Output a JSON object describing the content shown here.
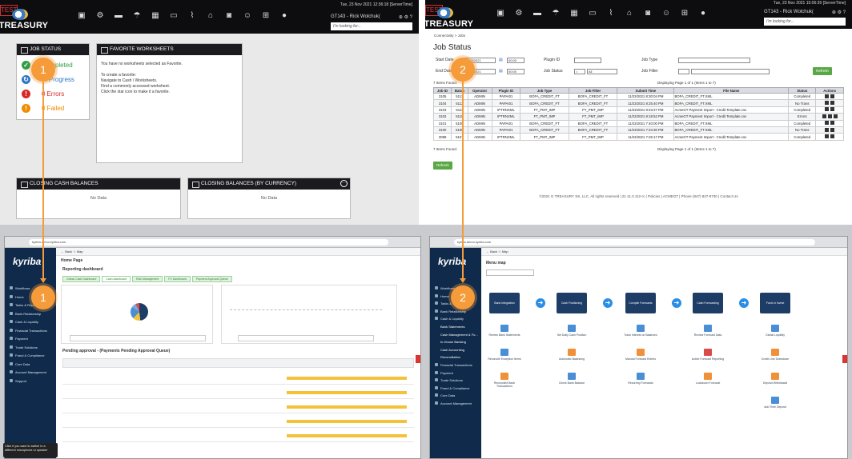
{
  "gtreasury": {
    "test_badge": "TEST",
    "logo_text": "GTREASURY",
    "server_time": "Tue, 23 Nov 2021 12:36:18 [ServerTime]",
    "server_time_2": "Tue, 23 Nov 2021 15:06:39 [ServerTime]",
    "user": "GT143 - Rick Wolchuk(",
    "user_2": "GT143 - Rick Wolchuk(",
    "search_placeholder": "I'm looking for...",
    "nav_icons": [
      "reports-icon",
      "settings-icon",
      "folder-icon",
      "cloud-icon",
      "calculator-icon",
      "monitor-icon",
      "pulse-icon",
      "bank-icon",
      "car-icon",
      "face-icon",
      "org-chart-icon",
      "egg-icon"
    ]
  },
  "job_status_widget": {
    "title": "JOB STATUS",
    "items": [
      {
        "count": "",
        "label": "Completed",
        "color": "#2f9e44",
        "symbol": "✓"
      },
      {
        "count": "",
        "label": "In Progress",
        "color": "#2f78c4",
        "symbol": "↻"
      },
      {
        "count": "0",
        "label": "Errors",
        "color": "#d62828",
        "symbol": "!"
      },
      {
        "count": "0",
        "label": "Failed",
        "color": "#f08c00",
        "symbol": "!"
      }
    ]
  },
  "favorite_worksheets": {
    "title": "FAVORITE WORKSHEETS",
    "empty_msg": "You have no worksheets selected as Favorite.",
    "howto_title": "To create a favorite:",
    "steps": [
      "Navigate to Cash \\ Worksheets.",
      "Find a commonly accessed worksheet.",
      "Click the star icon to make it a favorite."
    ]
  },
  "closing_cash": {
    "title": "CLOSING CASH BALANCES",
    "body": "No Data"
  },
  "closing_currency": {
    "title": "CLOSING BALANCES (BY CURRENCY)",
    "body": "No Data"
  },
  "markers": {
    "one": "1",
    "two": "2"
  },
  "job_status_page": {
    "breadcrumb": "Connectivity > Jobs",
    "title": "Job Status",
    "start_date_label": "Start Date",
    "end_date_label": "End Date",
    "start_date": "11/23/2021",
    "end_date": "11/23/2021",
    "time_start": "00:00",
    "time_end": "00:00",
    "plugin_id_label": "Plugin ID",
    "job_status_label": "Job Status",
    "job_status_op": "=",
    "job_status_value": "All",
    "job_type_label": "Job Type",
    "job_filter_label": "Job Filter",
    "refresh_label": "Refresh",
    "items_found": "7 Items Found.",
    "paging": "Displaying Page 1 of 1 (Items 1 to 7)",
    "columns": [
      "Job ID",
      "Batch",
      "Operator",
      "Plugin ID",
      "Job Type",
      "Job Filter",
      "Submit Time",
      "File Name",
      "Status",
      "Actions"
    ],
    "rows": [
      [
        "3105",
        "5113",
        "ADMIN",
        "PAPAI01",
        "BOFA_CREDIT_FT",
        "BOFA_CREDIT_FT",
        "11/23/2021 8:30:04 PM",
        "BOFA_CREDIT_FT.XML",
        "Completed"
      ],
      [
        "3104",
        "5112",
        "ADMIN",
        "PAPAI01",
        "BOFA_CREDIT_FT",
        "BOFA_CREDIT_FT",
        "11/23/2021 8:25:40 PM",
        "BOFA_CREDIT_FT.XML",
        "No Trans"
      ],
      [
        "3103",
        "5111",
        "ADMIN",
        "IPTRNXML",
        "FT_PMT_IMP",
        "FT_PMT_IMP",
        "11/23/2021 8:23:27 PM",
        "AcmeGT Payment Import - Credit Template.csv",
        "Completed"
      ],
      [
        "3102",
        "5110",
        "ADMIN",
        "IPTRNXML",
        "FT_PMT_IMP",
        "FT_PMT_IMP",
        "11/23/2021 8:18:52 PM",
        "AcmeGT Payment Import - Credit Template.csv",
        "Errors"
      ],
      [
        "3101",
        "5109",
        "ADMIN",
        "PAPAI01",
        "BOFA_CREDIT_FT",
        "BOFA_CREDIT_FT",
        "11/23/2021 7:40:00 PM",
        "BOFA_CREDIT_FT.XML",
        "Completed"
      ],
      [
        "3100",
        "5108",
        "ADMIN",
        "PAPAI01",
        "BOFA_CREDIT_FT",
        "BOFA_CREDIT_FT",
        "11/23/2021 7:34:30 PM",
        "BOFA_CREDIT_FT.XML",
        "No Trans"
      ],
      [
        "3099",
        "5107",
        "ADMIN",
        "IPTRNXML",
        "FT_PMT_IMP",
        "FT_PMT_IMP",
        "11/23/2021 7:26:17 PM",
        "AcmeGT Payment Import - Credit Template.csv",
        "Completed"
      ]
    ],
    "refresh_bottom": "Refresh",
    "footer": "©2021 G TREASURY SS, LLC. All rights reserved  |  21.11.0.112-rc  |  Policies  |  ACMEGT  |  Phone (847) 847-8730  |  Contact Us"
  },
  "kyriba_left": {
    "logo": "kyriba",
    "url": "kyriba.demo.kyriba.com",
    "breadcrumb": "Home Page",
    "dashboard_title": "Reporting dashboard",
    "tabs": [
      "Global Cash Dashboard",
      "Cash dashboard",
      "Risk Management",
      "FX Dashboard",
      "Payment Approval Queue"
    ],
    "pending_title": "Pending approval - (Payments Pending Approval Queue)",
    "sidebar": [
      "Workflows",
      "Home",
      "Tasks & Reports",
      "Bank Relationship",
      "Cash & Liquidity",
      "Financial Transactions",
      "Payment",
      "Trade Solutions",
      "Fraud & Compliance",
      "Core Data",
      "Account Management",
      "Support"
    ],
    "tooltip": "Click if you want to switch to a different microphone or speaker"
  },
  "kyriba_right": {
    "logo": "kyriba",
    "menu_title": "Menu map",
    "flow": [
      "Bank Integration",
      "Cash Positioning",
      "Compile Forecasts",
      "Cash Forecasting",
      "Fund or Invest"
    ],
    "tiles": [
      "Review Bank Statements",
      "Reconcile Exception Items",
      "Reconciled Bank Transactions",
      "Set Daily Cash Position",
      "Automatic Balancing",
      "Check Bank Balance",
      "Track Interest on Balances",
      "Manual Forecast Entries",
      "Recurring Forecasts",
      "Review Forecast Data",
      "Active Forecast Reporting",
      "Lockdown Forecast",
      "Global Liquidity",
      "Credit Line Drawdown",
      "Deposit Withdrawal",
      "Add Time Deposit"
    ],
    "sidebar": [
      "Workflows",
      "Home",
      "Tasks & Reports",
      "Bank Relationship",
      "Cash & Liquidity",
      "Bank Statements",
      "Cash Management & Fo...",
      "In-House Banking",
      "Cash Accounting",
      "Reconciliation",
      "Financial Transactions",
      "Payment",
      "Trade Solutions",
      "Fraud & Compliance",
      "Core Data",
      "Account Management"
    ]
  }
}
